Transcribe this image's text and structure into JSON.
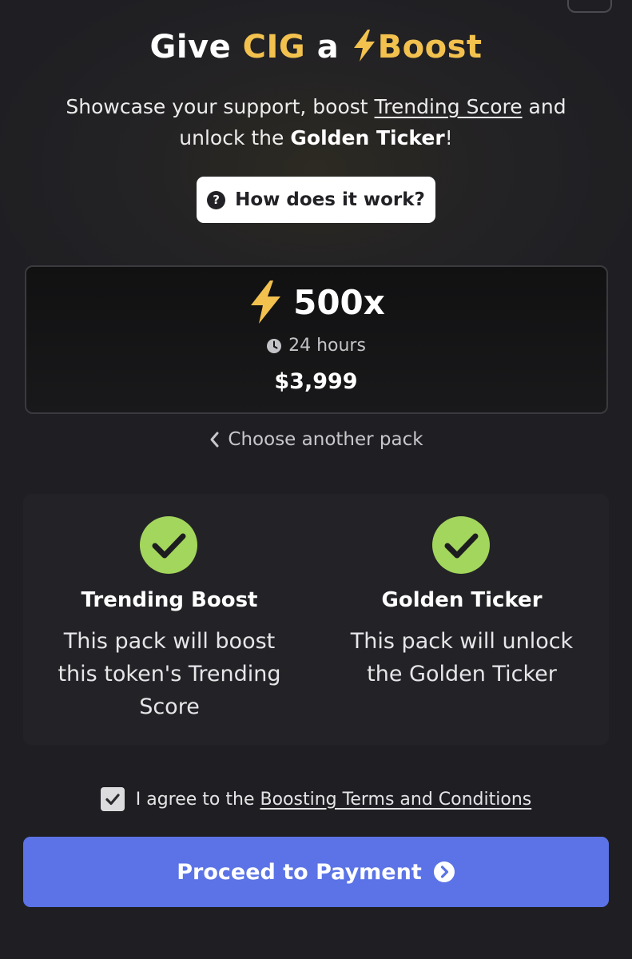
{
  "header": {
    "title_prefix": "Give",
    "title_token": "CIG",
    "title_mid": "a",
    "title_boost": "Boost",
    "subtitle_part1": "Showcase your support, boost",
    "subtitle_link": "Trending Score",
    "subtitle_part2": "and unlock the",
    "subtitle_bold": "Golden Ticker",
    "subtitle_end": "!",
    "how_button": "How does it work?"
  },
  "pack": {
    "multiplier": "500x",
    "duration": "24 hours",
    "price": "$3,999",
    "choose_another": "Choose another pack"
  },
  "features": [
    {
      "title": "Trending Boost",
      "description": "This pack will boost this token's Trending Score"
    },
    {
      "title": "Golden Ticker",
      "description": "This pack will unlock the Golden Ticker"
    }
  ],
  "agreement": {
    "checked": true,
    "text": "I agree to the",
    "link": "Boosting Terms and Conditions"
  },
  "proceed_button": "Proceed to Payment",
  "colors": {
    "gold": "#f2c14e",
    "accent": "#5b73e6",
    "check_green": "#a3d65c"
  },
  "icons": [
    "lightning-icon",
    "question-icon",
    "clock-icon",
    "chevron-left-icon",
    "check-circle-icon",
    "checkbox-check-icon",
    "arrow-right-circle-icon"
  ]
}
